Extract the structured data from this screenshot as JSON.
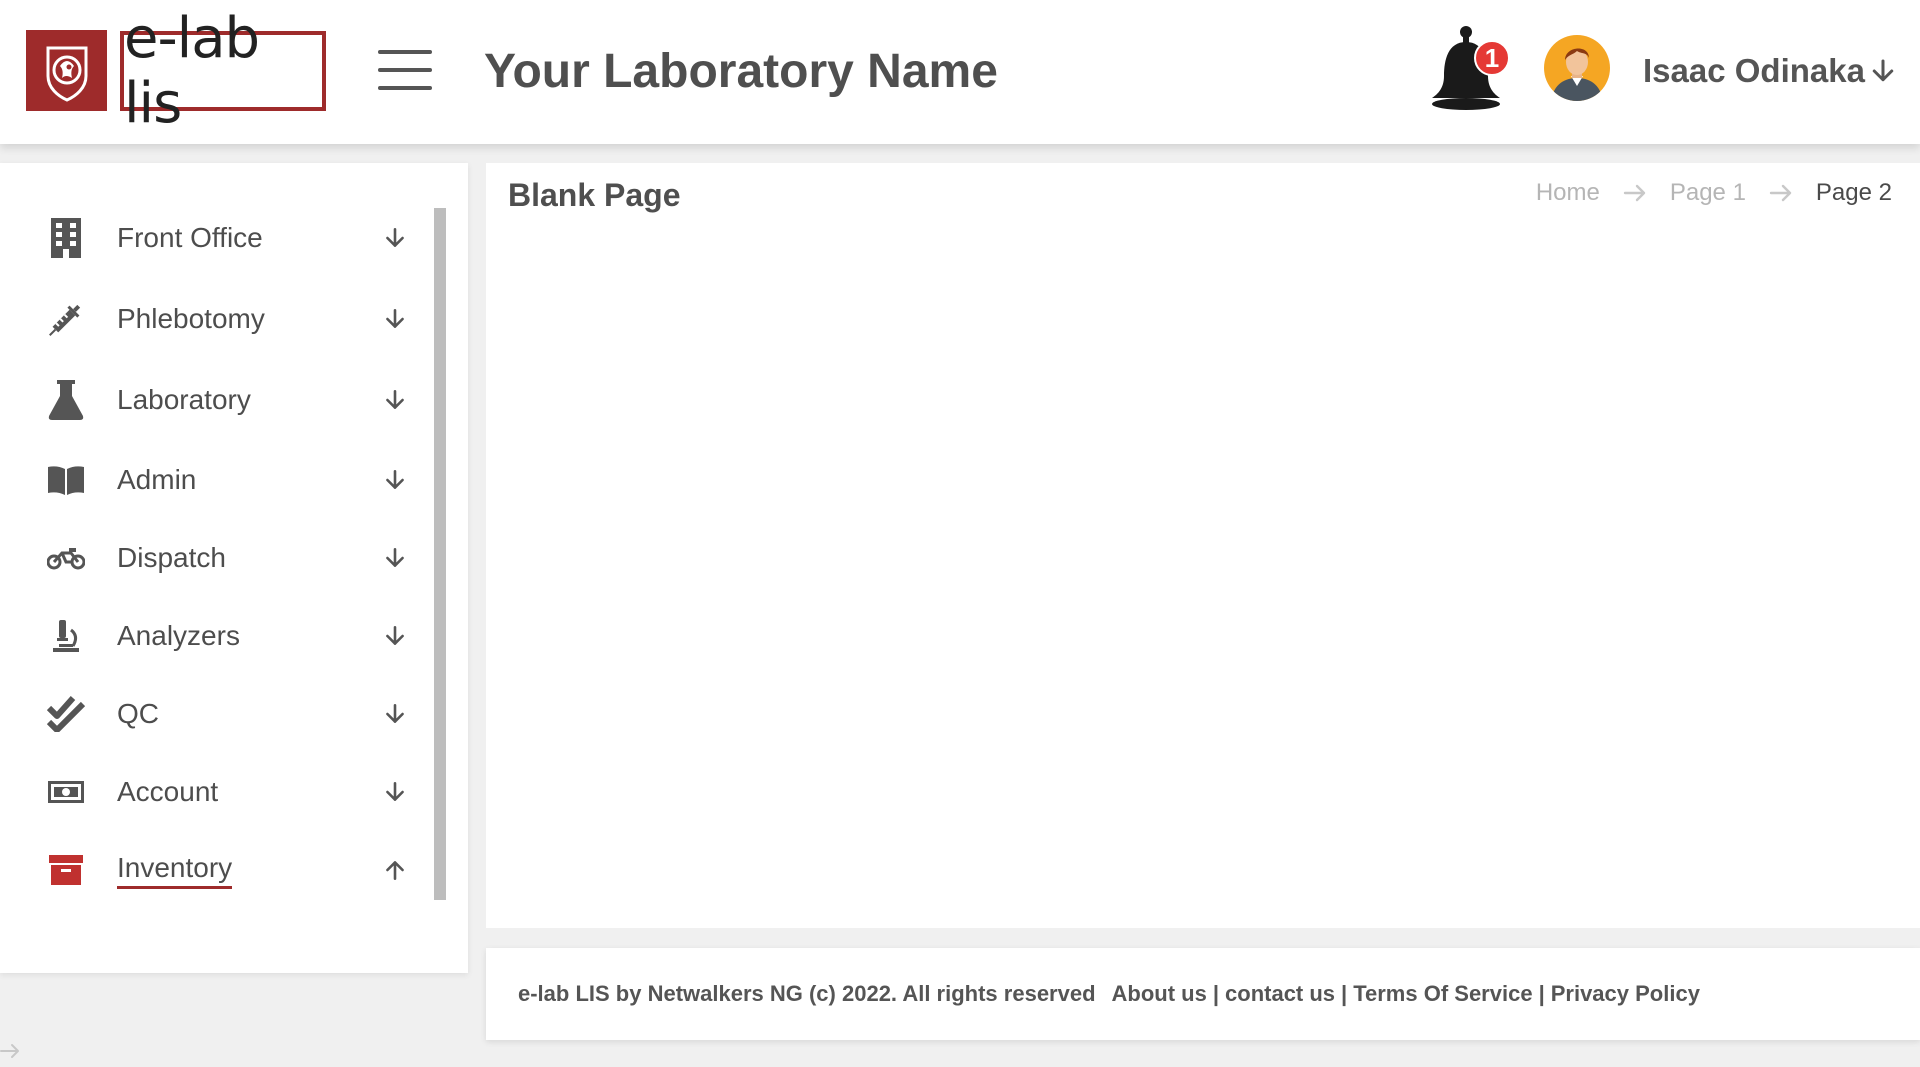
{
  "header": {
    "logo_text": "e-lab lis",
    "lab_name": "Your Laboratory Name",
    "notification_count": "1",
    "user_name": "Isaac Odinaka"
  },
  "sidebar": {
    "items": [
      {
        "label": "Front Office",
        "icon": "building-icon",
        "expanded": false
      },
      {
        "label": "Phlebotomy",
        "icon": "syringe-icon",
        "expanded": false
      },
      {
        "label": "Laboratory",
        "icon": "flask-icon",
        "expanded": false
      },
      {
        "label": "Admin",
        "icon": "book-icon",
        "expanded": false
      },
      {
        "label": "Dispatch",
        "icon": "motorcycle-icon",
        "expanded": false
      },
      {
        "label": "Analyzers",
        "icon": "microscope-icon",
        "expanded": false
      },
      {
        "label": "QC",
        "icon": "double-check-icon",
        "expanded": false
      },
      {
        "label": "Account",
        "icon": "money-bill-icon",
        "expanded": false
      },
      {
        "label": "Inventory",
        "icon": "archive-box-icon",
        "expanded": true,
        "active": true
      }
    ]
  },
  "main": {
    "title": "Blank Page",
    "breadcrumb": [
      "Home",
      "Page 1",
      "Page 2"
    ]
  },
  "footer": {
    "copyright": "e-lab LIS by Netwalkers NG (c) 2022. All rights reserved",
    "links": [
      "About us",
      "contact us",
      "Terms Of Service",
      "Privacy Policy"
    ]
  },
  "colors": {
    "brand": "#9e2b2b",
    "text": "#4d4d4d",
    "muted": "#b5b5b5",
    "badge": "#e53935"
  }
}
